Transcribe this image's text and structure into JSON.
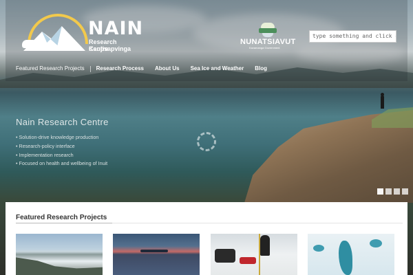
{
  "site": {
    "name": "NAIN",
    "subtitle_line1": "Research Centre",
    "subtitle_line2": "Kaujisapvinga"
  },
  "government": {
    "name": "NUNATSIAVUT",
    "tagline": "Kavamanga   Government"
  },
  "search": {
    "placeholder": "type something and click enter"
  },
  "nav": {
    "items": [
      {
        "label": "Featured Research Projects"
      },
      {
        "label": "Research Process"
      },
      {
        "label": "About Us"
      },
      {
        "label": "Sea Ice and Weather"
      },
      {
        "label": "Blog"
      }
    ]
  },
  "slider": {
    "title": "Nain Research Centre",
    "bullets": [
      "Solution-drive knowledge production",
      "Research-policy interface",
      "Implementation research",
      "Focused on health and wellbeing of Inuit"
    ],
    "slide_count": 4,
    "active_slide": 1
  },
  "featured": {
    "title": "Featured Research Projects",
    "thumbnails": [
      {
        "icon": "landscape-photo"
      },
      {
        "icon": "sunset-photo"
      },
      {
        "icon": "ice-drilling-photo"
      },
      {
        "icon": "sea-ice-photo"
      }
    ]
  }
}
